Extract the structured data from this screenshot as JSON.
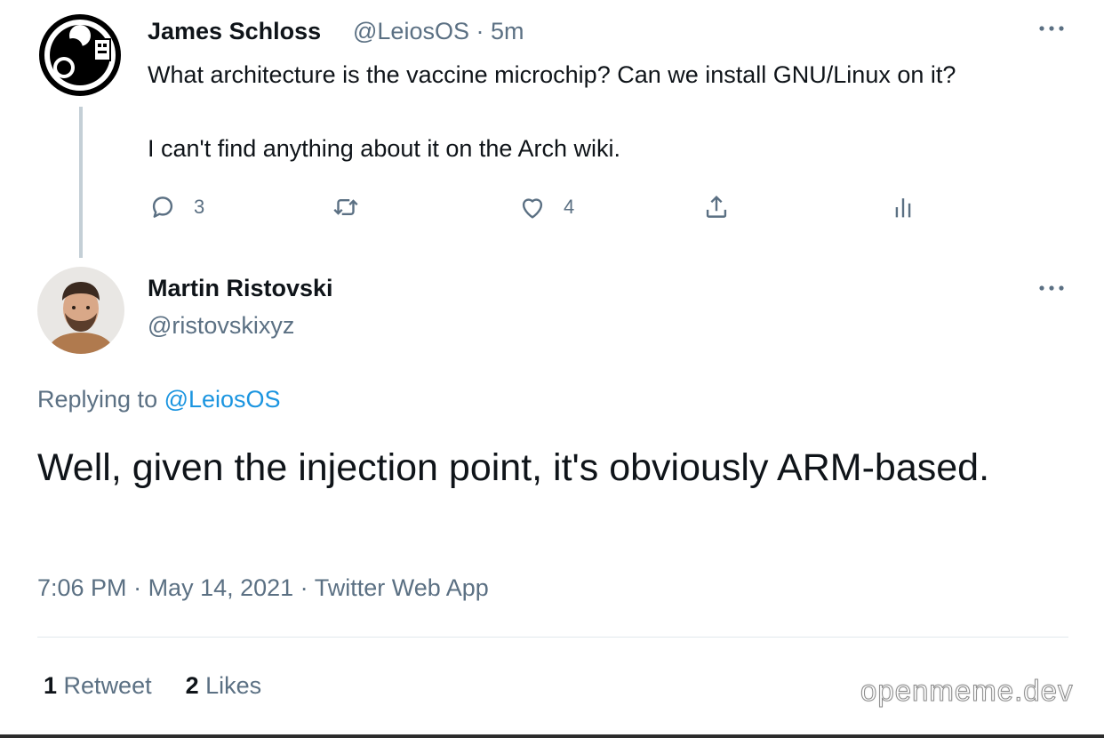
{
  "tweet1": {
    "name": "James Schloss",
    "handle_time": "@LeiosOS · 5m",
    "text_line1": "What architecture is the vaccine microchip? Can we install GNU/Linux on it?",
    "text_line2": "I can't find anything about it on the Arch wiki.",
    "reply_count": "3",
    "like_count": "4"
  },
  "tweet2": {
    "name": "Martin Ristovski",
    "handle": "@ristovskixyz",
    "replying_prefix": "Replying to ",
    "replying_handle": "@LeiosOS",
    "text": "Well, given the injection point, it's obviously ARM-based.",
    "time": "7:06 PM",
    "date": "May 14, 2021",
    "source": "Twitter Web App",
    "retweets_count": "1",
    "retweets_label": "Retweet",
    "likes_count": "2",
    "likes_label": "Likes"
  },
  "watermark": "openmeme.dev",
  "colors": {
    "link": "#1b95e0",
    "muted": "#5b7083",
    "text": "#0f1419",
    "divider": "#e1e8ed"
  },
  "icons": [
    "reply-icon",
    "retweet-icon",
    "like-icon",
    "share-icon",
    "analytics-icon",
    "more-icon"
  ]
}
